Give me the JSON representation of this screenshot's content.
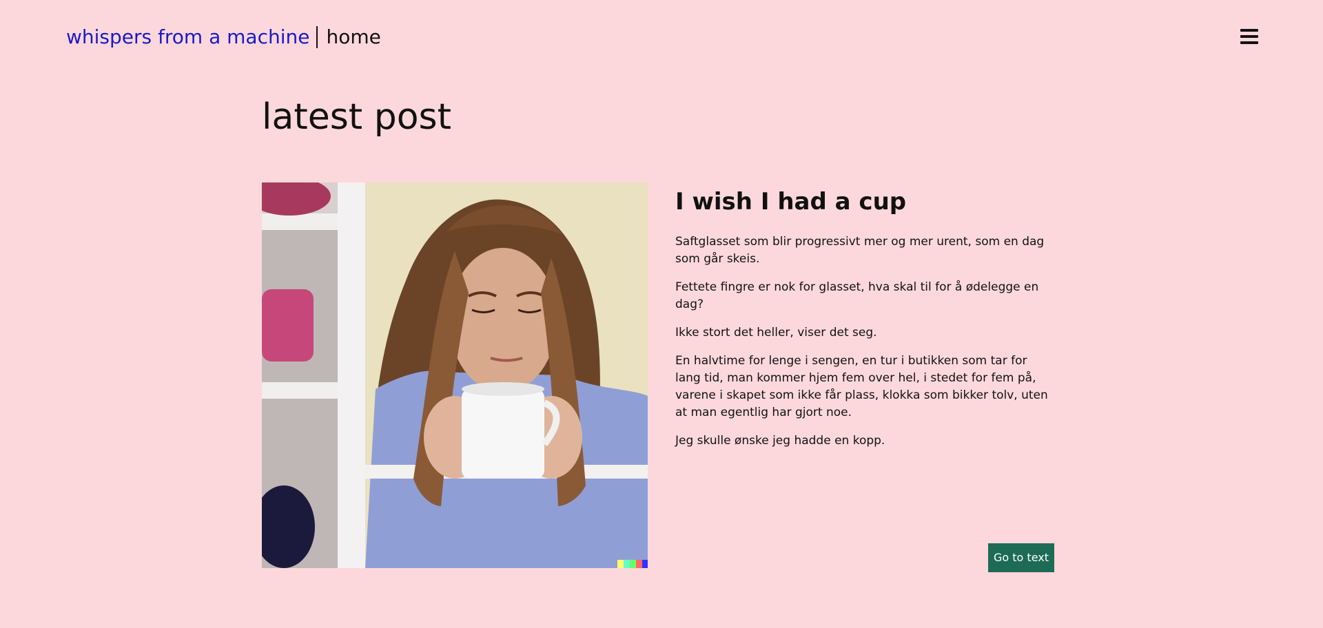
{
  "header": {
    "site_title": "whispers from a machine",
    "current_page": "home",
    "menu_icon": "hamburger-menu-icon"
  },
  "main": {
    "section_title": "latest post",
    "post": {
      "title": "I wish I had a cup",
      "image_alt": "woman holding a white coffee mug",
      "paragraphs": [
        "Saftglasset som blir progressivt mer og mer urent, som en dag som går skeis.",
        "Fettete fingre er nok for glasset, hva skal til for å ødelegge en dag?",
        "Ikke stort det heller, viser det seg.",
        "En halvtime for lenge i sengen, en tur i butikken som tar for lang tid, man kommer hjem fem over hel, i stedet for fem på, varene i skapet som ikke får plass, klokka som bikker tolv, uten at man egentlig har gjort noe.",
        "Jeg skulle ønske jeg hadde en kopp."
      ],
      "button_label": "Go to text"
    }
  },
  "colors": {
    "background": "#fcd8dc",
    "link": "#1a1ac8",
    "button": "#1d6b55",
    "text": "#111111"
  }
}
